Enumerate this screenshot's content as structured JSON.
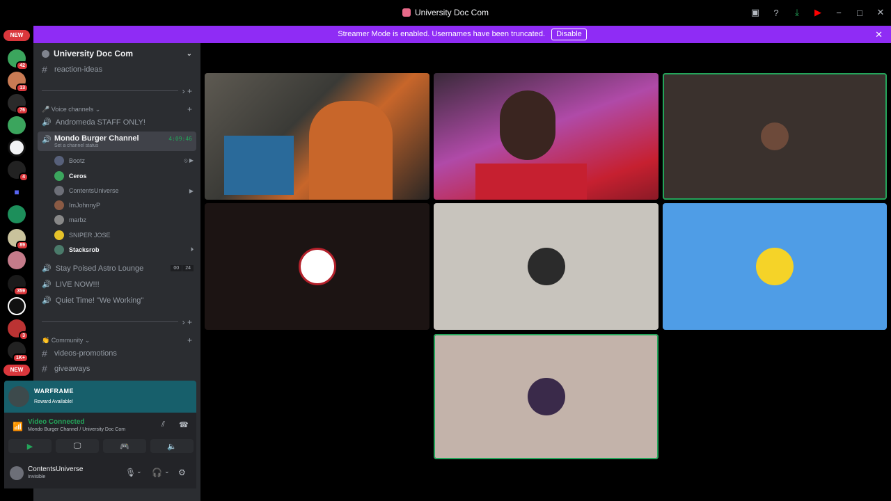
{
  "window": {
    "title": "University Doc Com"
  },
  "banner": {
    "text": "Streamer Mode is enabled. Usernames have been truncated.",
    "button": "Disable"
  },
  "server_rail": {
    "new_top": "NEW",
    "new_bottom": "NEW",
    "badges": [
      "42",
      "13",
      "76",
      "4",
      "89",
      "359",
      "3",
      "1K+"
    ]
  },
  "guild": {
    "name": "University Doc Com"
  },
  "channels": {
    "reaction": "reaction-ideas",
    "voice_category": "Voice channels",
    "andromeda": "Andromeda STAFF ONLY!",
    "active_voice": {
      "name": "Mondo Burger Channel",
      "status": "Set a channel status",
      "time": "4:09:46"
    },
    "members": [
      "Bootz",
      "Ceros",
      "ContentsUniverse",
      "ImJohnnyP",
      "marbz",
      "SNIPER JOSE",
      "Stacksrob"
    ],
    "lounge": "Stay Poised Astro Lounge",
    "lounge_count_a": "00",
    "lounge_count_b": "24",
    "live_now": "LIVE NOW!!!",
    "quiet": "Quiet Time! \"We Working\"",
    "community_category": "Community",
    "videos": "videos-promotions",
    "giveaways": "giveaways"
  },
  "promo": {
    "title": "WARFRAME",
    "subtitle": "Reward Available!"
  },
  "rtc": {
    "status": "Video Connected",
    "location": "Mondo Burger Channel / University Doc Com"
  },
  "user": {
    "name": "ContentsUniverse",
    "status": "Invisible"
  },
  "colors": {
    "accent": "#8f2cf5",
    "green": "#23a55a",
    "tile_blue": "#4f9de6"
  }
}
